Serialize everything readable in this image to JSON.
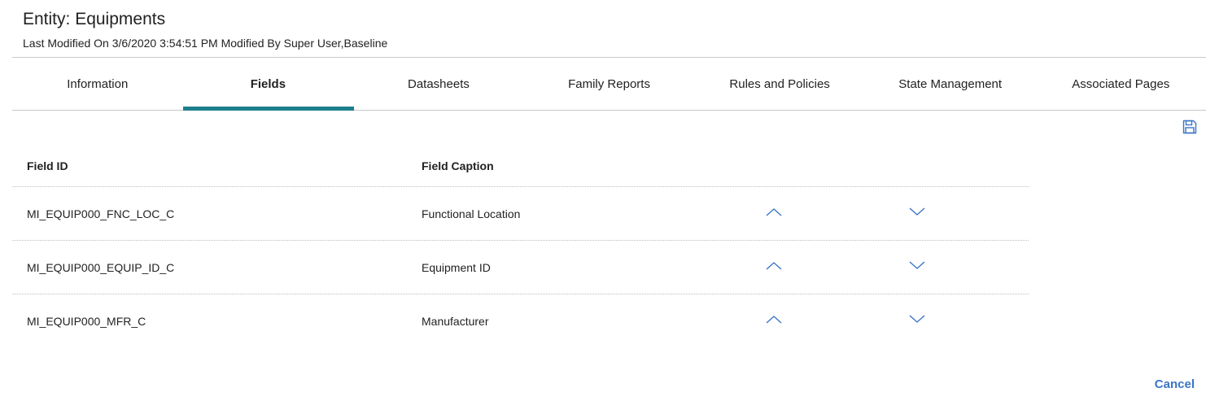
{
  "header": {
    "title": "Entity: Equipments",
    "subtitle": "Last Modified On 3/6/2020 3:54:51 PM Modified By Super User,Baseline"
  },
  "tabs": [
    {
      "label": "Information",
      "active": false
    },
    {
      "label": "Fields",
      "active": true
    },
    {
      "label": "Datasheets",
      "active": false
    },
    {
      "label": "Family Reports",
      "active": false
    },
    {
      "label": "Rules and Policies",
      "active": false
    },
    {
      "label": "State Management",
      "active": false
    },
    {
      "label": "Associated Pages",
      "active": false
    }
  ],
  "toolbar": {
    "save_icon": "floppy-disk-icon"
  },
  "table": {
    "headers": {
      "field_id": "Field ID",
      "field_caption": "Field Caption"
    },
    "rows": [
      {
        "field_id": "MI_EQUIP000_FNC_LOC_C",
        "field_caption": "Functional Location"
      },
      {
        "field_id": "MI_EQUIP000_EQUIP_ID_C",
        "field_caption": "Equipment ID"
      },
      {
        "field_id": "MI_EQUIP000_MFR_C",
        "field_caption": "Manufacturer"
      }
    ]
  },
  "footer": {
    "cancel_label": "Cancel"
  },
  "colors": {
    "accent": "#1e7f8c",
    "link": "#3a75c4",
    "icon": "#3a75c4"
  }
}
